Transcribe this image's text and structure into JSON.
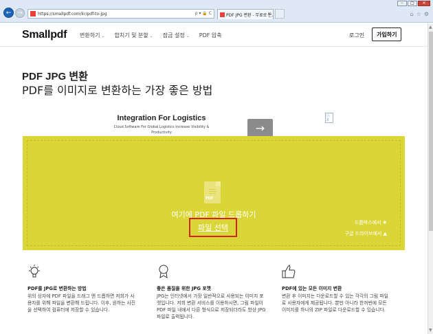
{
  "browser": {
    "address": "https://smallpdf.com/kr/pdf-to-jpg",
    "address_tools": "ρ ▾ 🔒 C",
    "tab_title": "PDF JPG 변환 - 무료로 온...",
    "back_icon": "back-arrow-icon",
    "forward_icon": "forward-arrow-icon"
  },
  "nav": {
    "logo": "Smallpdf",
    "menu": [
      {
        "label": "변환하기"
      },
      {
        "label": "합치기 및 분할"
      },
      {
        "label": "잠금 설정"
      },
      {
        "label": "PDF 압축"
      }
    ],
    "login": "로그인",
    "signup": "가입하기"
  },
  "hero": {
    "title": "PDF JPG 변환",
    "subtitle": "PDF를 이미지로 변환하는 가장 좋은 방법"
  },
  "ad": {
    "title": "Integration For Logistics",
    "subtitle": "Cloud Software For Global Logistics Increase Visibility & Productivity",
    "arrow": "→",
    "badge": "ⓘ X"
  },
  "dropzone": {
    "icon_label": "PDF",
    "drop_text": "여기에 PDF 파일 드롭하기",
    "choose_file": "파일 선택",
    "dropbox": "드롭박스에서",
    "google_drive": "구글 드라이브에서",
    "accent_color": "#dbd637"
  },
  "features": [
    {
      "icon": "lightbulb-icon",
      "title": "PDF를 JPG로 변환하는 방법",
      "desc": "위의 상자에 PDF 파일을 드래그 앤 드롭하면 저희가 사용자를 위해 파일을 변환해 드립니다. 이후, 원하는 사진을 선택하여 컴퓨터에 저장할 수 있습니다."
    },
    {
      "icon": "award-ribbon-icon",
      "title": "좋은 품질을 위한 JPG 포맷",
      "desc": "JPG는 인터넷에서 가장 일반적으로 사용되는 이미지 포맷입니다. 저희 변환 서비스를 이용하시면, 그림 파일이 PDF 파일 내에서 다른 형식으로 저장되더라도 항상 JPG 파일로 출력됩니다."
    },
    {
      "icon": "thumbs-up-icon",
      "title": "PDF에 있는 모든 이미지 변환",
      "desc": "변환 후 이미지는 다운로드할 수 있는 각각의 그림 파일로 사용자에게 제공됩니다. 뿐만 아니라 한꺼번에 모든 이미지를 하나의 ZIP 파일로 다운로드할 수 있습니다."
    }
  ]
}
